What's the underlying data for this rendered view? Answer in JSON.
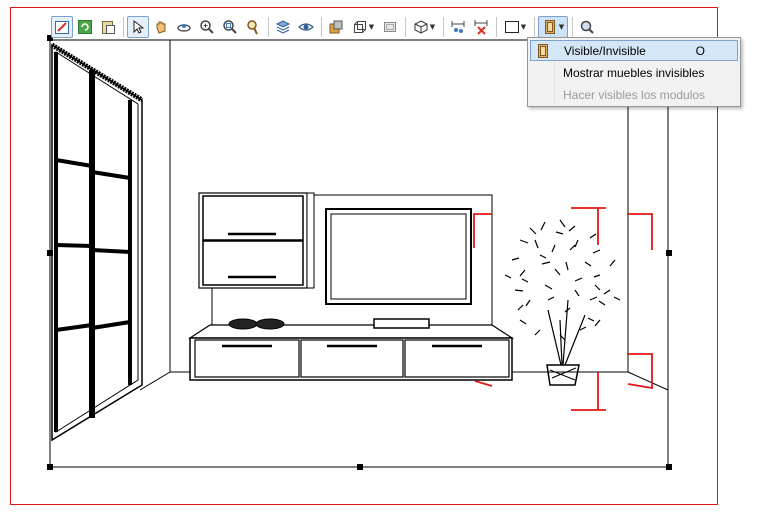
{
  "toolbar": {
    "buttons": [
      {
        "id": "edit-properties",
        "icon": "edit-icon"
      },
      {
        "id": "refresh",
        "icon": "refresh-icon"
      },
      {
        "id": "clipboard",
        "icon": "clipboard-icon"
      },
      {
        "id": "select",
        "icon": "cursor-icon",
        "active": true
      },
      {
        "id": "pan",
        "icon": "hand-icon"
      },
      {
        "id": "orbit",
        "icon": "orbit-icon"
      },
      {
        "id": "zoom-in",
        "icon": "zoom-in-icon"
      },
      {
        "id": "zoom-window",
        "icon": "zoom-window-icon"
      },
      {
        "id": "zoom-extents",
        "icon": "zoom-extents-icon"
      },
      {
        "id": "layers",
        "icon": "layers-icon"
      },
      {
        "id": "visibility",
        "icon": "eye-icon"
      },
      {
        "id": "render",
        "icon": "render-icon"
      },
      {
        "id": "view-3d",
        "icon": "cube-wire-icon"
      },
      {
        "id": "plan-view",
        "icon": "plan-view-icon"
      },
      {
        "id": "solid-view",
        "icon": "cube-icon"
      },
      {
        "id": "dimensions",
        "icon": "dimensions-icon"
      },
      {
        "id": "delete-dimensions",
        "icon": "delete-dimensions-icon"
      },
      {
        "id": "frame",
        "icon": "frame-icon"
      },
      {
        "id": "module-visibility",
        "icon": "door-icon",
        "open": true
      },
      {
        "id": "search-parts",
        "icon": "search-icon"
      }
    ]
  },
  "menu": {
    "items": [
      {
        "label": "Visible/Invisible",
        "shortcut": "O",
        "highlighted": true,
        "enabled": true,
        "icon": "door-icon"
      },
      {
        "label": "Mostrar muebles invisibles",
        "shortcut": "",
        "highlighted": false,
        "enabled": true
      },
      {
        "label": "Hacer visibles los modulos",
        "shortcut": "",
        "highlighted": false,
        "enabled": false
      }
    ]
  },
  "colors": {
    "viewport_border": "#e01818",
    "menu_highlight": "#d5e6f9",
    "menu_highlight_border": "#7da2ce",
    "dimension_marks": "#e01818"
  }
}
